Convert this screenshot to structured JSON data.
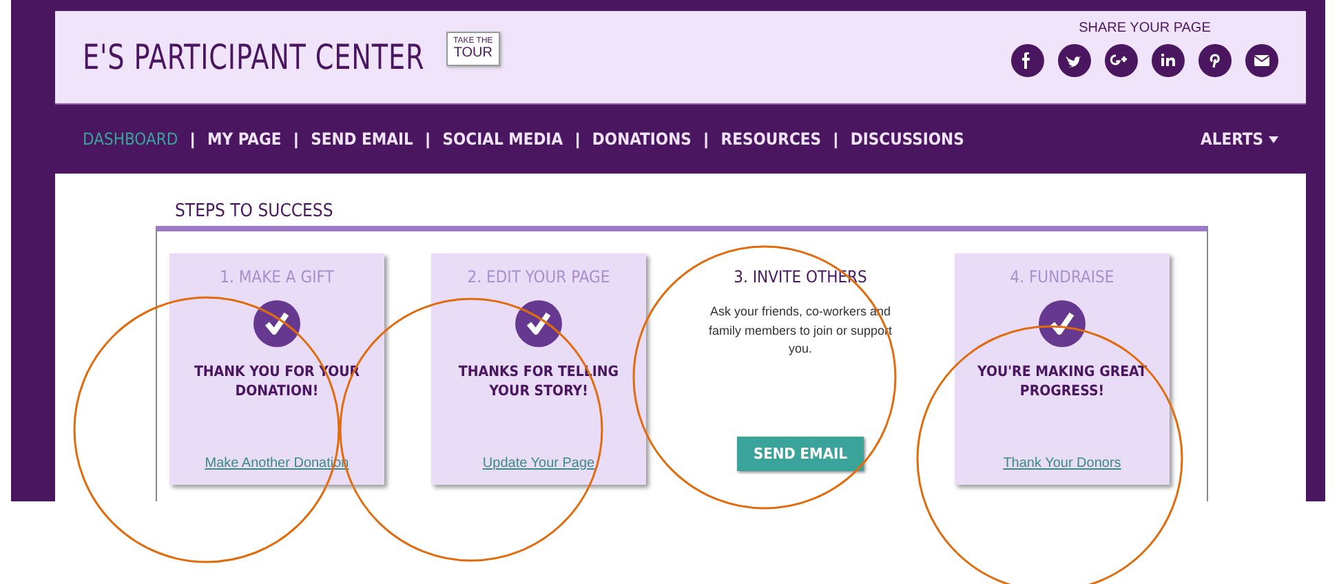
{
  "header": {
    "title": "E'S PARTICIPANT CENTER",
    "tour_button": [
      "TAKE THE",
      "TOUR"
    ],
    "share": {
      "label": "SHARE YOUR PAGE",
      "networks": [
        {
          "kind": "facebook"
        },
        {
          "kind": "twitter"
        },
        {
          "kind": "googleplus"
        },
        {
          "kind": "linkedin"
        },
        {
          "kind": "pinterest"
        },
        {
          "kind": "email"
        }
      ]
    }
  },
  "nav": {
    "separator": "|",
    "items": [
      {
        "label": "DASHBOARD",
        "selected": true
      },
      {
        "label": "MY PAGE",
        "selected": false
      },
      {
        "label": "SEND EMAIL",
        "selected": false
      },
      {
        "label": "SOCIAL MEDIA",
        "selected": false
      },
      {
        "label": "DONATIONS",
        "selected": false
      },
      {
        "label": "RESOURCES",
        "selected": false
      },
      {
        "label": "DISCUSSIONS",
        "selected": false
      }
    ],
    "alerts": "ALERTS"
  },
  "steps": {
    "title": "STEPS TO SUCCESS",
    "items": [
      {
        "kind": "done",
        "title": "1. MAKE A GIFT",
        "message": "THANK YOU FOR YOUR DONATION!",
        "link": "Make Another Donation"
      },
      {
        "kind": "done",
        "title": "2. EDIT YOUR PAGE",
        "message": "THANKS FOR TELLING YOUR STORY!",
        "link": "Update Your Page"
      },
      {
        "kind": "active",
        "title": "3. INVITE OTHERS",
        "description": "Ask your friends, co-workers and family members to join or support you.",
        "button": "SEND EMAIL"
      },
      {
        "kind": "done",
        "title": "4. FUNDRAISE",
        "message": "YOU'RE MAKING GREAT PROGRESS!",
        "link": "Thank Your Donors"
      }
    ]
  }
}
